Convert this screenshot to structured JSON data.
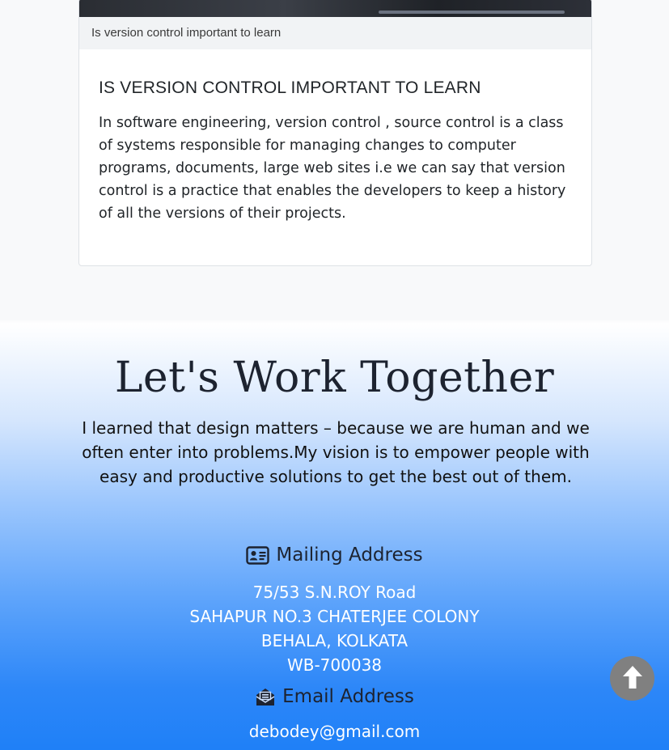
{
  "blog_card": {
    "image_caption": "Is version control important to learn",
    "title": "IS VERSION CONTROL IMPORTANT TO LEARN",
    "body": "In software engineering, version control , source control is a class of systems responsible for managing changes to computer programs, documents, large web sites i.e we can say that version control is a practice that enables the developers to keep a history of all the versions of their projects."
  },
  "contact_section": {
    "title": "Let's Work Together",
    "intro": "I learned that design matters – because we are human and we often enter into problems.My vision is to empower people with easy and productive solutions to get the best out of them.",
    "mailing": {
      "icon": "address-card-icon",
      "heading": "Mailing Address",
      "lines": [
        "75/53 S.N.ROY Road",
        "SAHAPUR NO.3 CHATERJEE COLONY",
        "BEHALA, KOLKATA",
        "WB-700038"
      ]
    },
    "email": {
      "icon": "envelope-open-icon",
      "heading": "Email Address",
      "value": "debodey@gmail.com"
    }
  },
  "scroll_top": {
    "icon": "arrow-up-icon"
  },
  "colors": {
    "scroll_button": "#808080",
    "gradient_bottom": "#1f80f7",
    "heading_text": "#1d2330"
  }
}
